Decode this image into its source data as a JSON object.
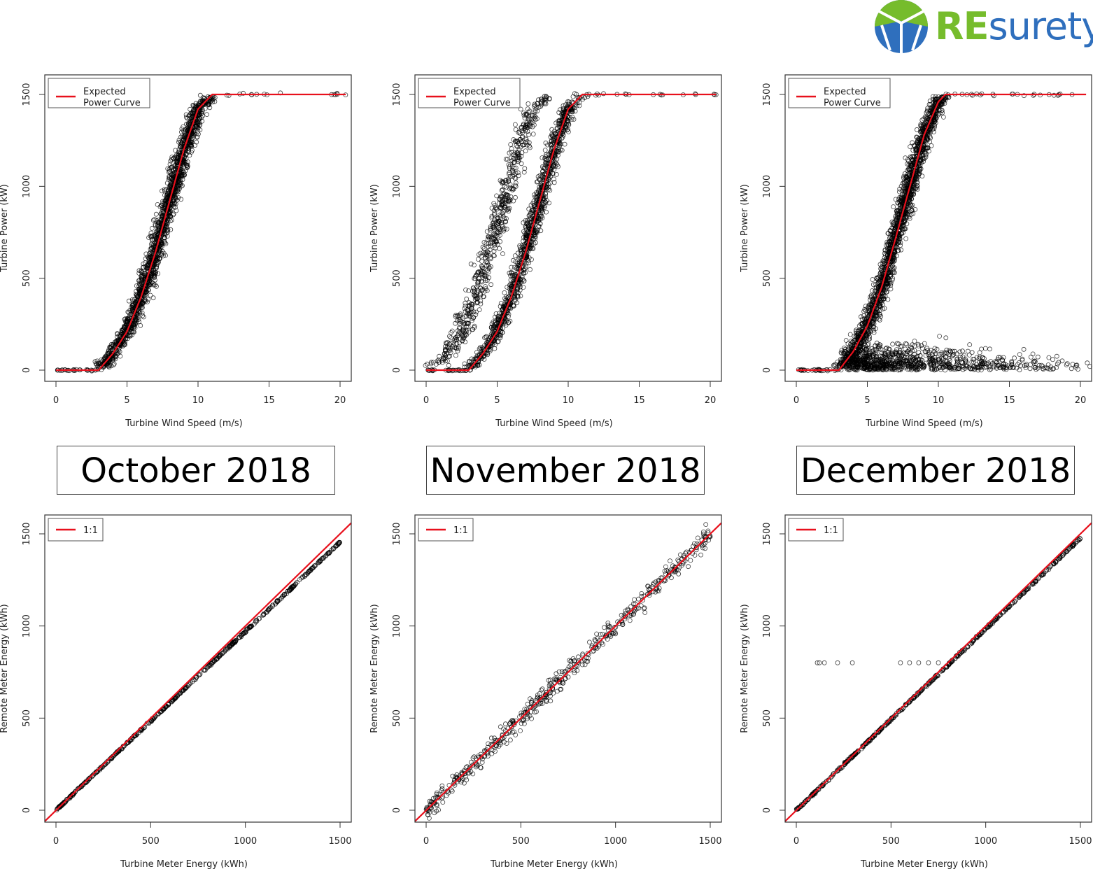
{
  "logo": {
    "re": "RE",
    "rest": "surety",
    "colors": {
      "green": "#76bc2c",
      "blue": "#2f6fbd"
    }
  },
  "months": [
    "October 2018",
    "November 2018",
    "December 2018"
  ],
  "colors": {
    "points": "#000000",
    "reference_line": "#e8101c"
  },
  "chart_data": [
    {
      "type": "scatter",
      "panel": "October 2018 power curve",
      "xlabel": "Turbine Wind Speed (m/s)",
      "ylabel": "Turbine Power (kW)",
      "xlim": [
        0,
        20.5
      ],
      "ylim": [
        0,
        1500
      ],
      "xticks": [
        0,
        5,
        10,
        15,
        20
      ],
      "yticks": [
        0,
        500,
        1000,
        1500
      ],
      "legend": {
        "position": "top-left",
        "entries": [
          "Expected Power Curve"
        ]
      },
      "reference_curve": {
        "name": "Expected Power Curve",
        "x": [
          0,
          3,
          4,
          5,
          6,
          7,
          8,
          9,
          10,
          11,
          20.5
        ],
        "y": [
          0,
          0,
          90,
          210,
          400,
          640,
          920,
          1200,
          1420,
          1500,
          1500
        ]
      },
      "pattern": "tight band around expected curve, spread ~±1 m/s"
    },
    {
      "type": "scatter",
      "panel": "November 2018 power curve",
      "xlabel": "Turbine Wind Speed (m/s)",
      "ylabel": "Turbine Power (kW)",
      "xlim": [
        0,
        20.5
      ],
      "ylim": [
        0,
        1500
      ],
      "xticks": [
        0,
        5,
        10,
        15,
        20
      ],
      "yticks": [
        0,
        500,
        1000,
        1500
      ],
      "legend": {
        "position": "top-left",
        "entries": [
          "Expected Power Curve"
        ]
      },
      "reference_curve": {
        "name": "Expected Power Curve",
        "x": [
          0,
          3,
          4,
          5,
          6,
          7,
          8,
          9,
          10,
          11,
          20.5
        ],
        "y": [
          0,
          0,
          90,
          210,
          400,
          640,
          920,
          1200,
          1420,
          1500,
          1500
        ]
      },
      "pattern": "main band around curve plus secondary band shifted ~2.5 m/s left"
    },
    {
      "type": "scatter",
      "panel": "December 2018 power curve",
      "xlabel": "Turbine Wind Speed (m/s)",
      "ylabel": "Turbine Power (kW)",
      "xlim": [
        0,
        20.5
      ],
      "ylim": [
        0,
        1500
      ],
      "xticks": [
        0,
        5,
        10,
        15,
        20
      ],
      "yticks": [
        0,
        500,
        1000,
        1500
      ],
      "legend": {
        "position": "top-left",
        "entries": [
          "Expected Power Curve"
        ]
      },
      "reference_curve": {
        "name": "Expected Power Curve",
        "x": [
          0,
          3,
          4,
          5,
          6,
          7,
          8,
          9,
          10,
          10.5,
          20.5
        ],
        "y": [
          0,
          0,
          100,
          240,
          450,
          720,
          1000,
          1280,
          1460,
          1500,
          1500
        ]
      },
      "pattern": "band around curve plus curtailed cloud 0-250 kW extending to 20 m/s"
    },
    {
      "type": "scatter",
      "panel": "October 2018 energy",
      "xlabel": "Turbine Meter Energy (kWh)",
      "ylabel": "Remote Meter Energy (kWh)",
      "xlim": [
        0,
        1500
      ],
      "ylim": [
        0,
        1500
      ],
      "xticks": [
        0,
        500,
        1000,
        1500
      ],
      "yticks": [
        0,
        500,
        1000,
        1500
      ],
      "legend": {
        "position": "top-left",
        "entries": [
          "1:1"
        ]
      },
      "reference_curve": {
        "name": "1:1",
        "x": [
          0,
          1500
        ],
        "y": [
          0,
          1500
        ]
      },
      "pattern": "tight, slightly below 1:1 (~0.97 ratio)"
    },
    {
      "type": "scatter",
      "panel": "November 2018 energy",
      "xlabel": "Turbine Meter Energy (kWh)",
      "ylabel": "Remote Meter Energy (kWh)",
      "xlim": [
        0,
        1500
      ],
      "ylim": [
        0,
        1500
      ],
      "xticks": [
        0,
        500,
        1000,
        1500
      ],
      "yticks": [
        0,
        500,
        1000,
        1500
      ],
      "legend": {
        "position": "top-left",
        "entries": [
          "1:1"
        ]
      },
      "reference_curve": {
        "name": "1:1",
        "x": [
          0,
          1500
        ],
        "y": [
          0,
          1500
        ]
      },
      "pattern": "scatter ±~80 kWh about 1:1"
    },
    {
      "type": "scatter",
      "panel": "December 2018 energy",
      "xlabel": "Turbine Meter Energy (kWh)",
      "ylabel": "Remote Meter Energy (kWh)",
      "xlim": [
        0,
        1500
      ],
      "ylim": [
        0,
        1500
      ],
      "xticks": [
        0,
        500,
        1000,
        1500
      ],
      "yticks": [
        0,
        500,
        1000,
        1500
      ],
      "legend": {
        "position": "top-left",
        "entries": [
          "1:1"
        ]
      },
      "reference_curve": {
        "name": "1:1",
        "x": [
          0,
          1500
        ],
        "y": [
          0,
          1500
        ]
      },
      "pattern": "tight on 1:1 with horizontal outliers",
      "outliers": {
        "x": [
          111,
          122,
          148,
          218,
          296,
          550,
          598,
          646,
          698,
          750
        ],
        "y": [
          800,
          800,
          800,
          800,
          800,
          800,
          800,
          800,
          800,
          800
        ]
      }
    }
  ]
}
